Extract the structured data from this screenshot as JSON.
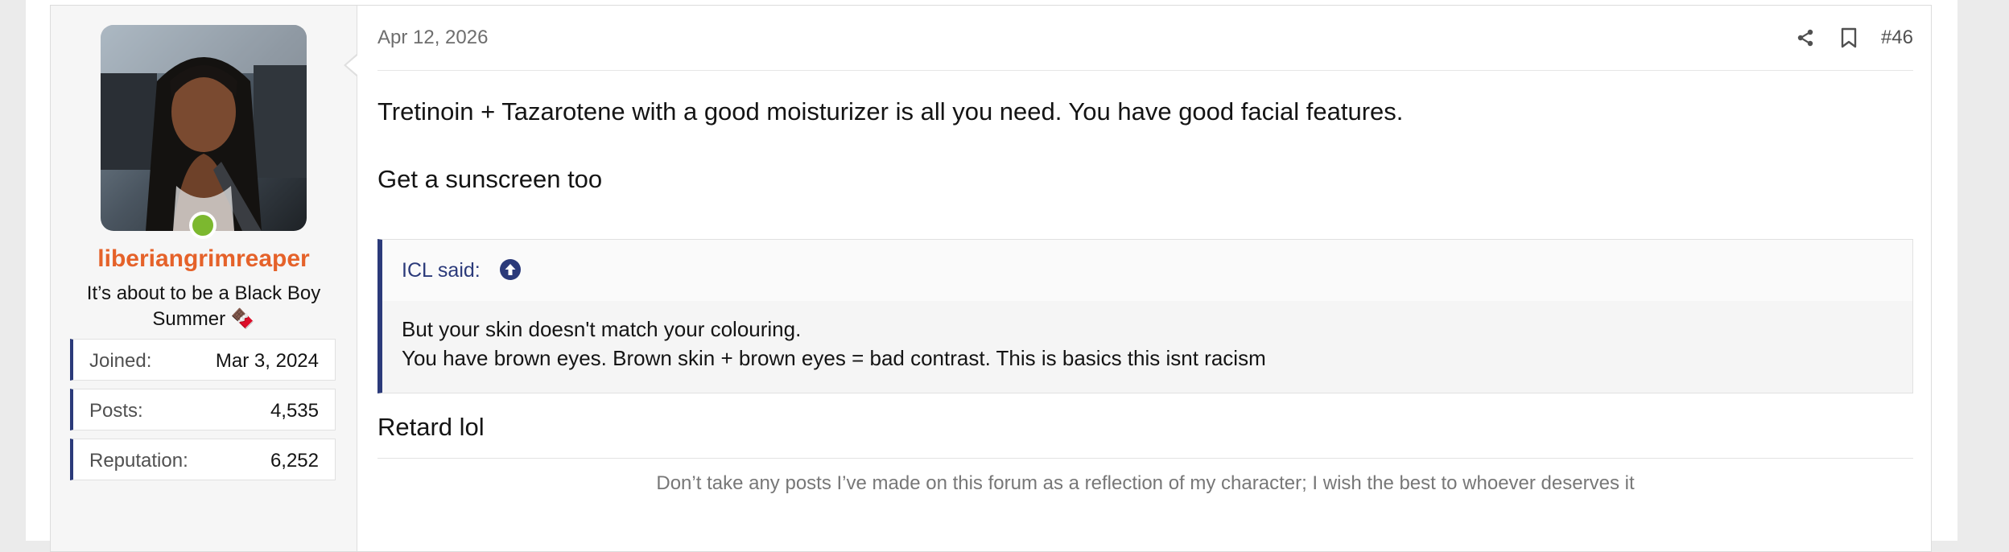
{
  "post": {
    "date": "Apr 12, 2026",
    "number": "#46",
    "body": {
      "line1": "Tretinoin + Tazarotene with a good moisturizer is all you need. You have good facial features.",
      "line2": "Get a sunscreen too",
      "reply": "Retard lol"
    },
    "quote": {
      "author": "ICL said:",
      "lines": [
        "But your skin doesn't match your colouring.",
        "You have brown eyes. Brown skin + brown eyes = bad contrast. This is basics this isnt racism"
      ]
    },
    "signature": "Don’t take any posts I’ve made on this forum as a reflection of my character; I wish the best to whoever deserves it"
  },
  "user": {
    "name": "liberiangrimreaper",
    "title": "It’s about to be a Black Boy Summer 🍫",
    "online": true,
    "stats": [
      {
        "label": "Joined:",
        "value": "Mar 3, 2024"
      },
      {
        "label": "Posts:",
        "value": "4,535"
      },
      {
        "label": "Reputation:",
        "value": "6,252"
      }
    ]
  },
  "icons": {
    "share": "share-icon",
    "bookmark": "bookmark-icon",
    "quote_jump": "arrow-up-circle-icon"
  },
  "colors": {
    "username": "#e5622a",
    "accent": "#2b3a7a",
    "online": "#7cb82f"
  }
}
